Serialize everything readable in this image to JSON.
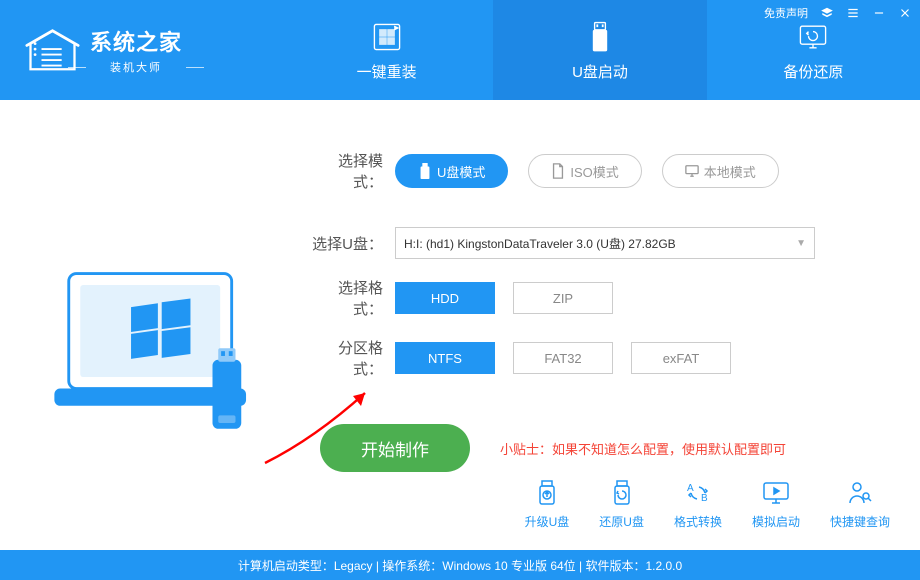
{
  "titlebar": {
    "disclaimer": "免责声明"
  },
  "logo": {
    "title": "系统之家",
    "subtitle": "装机大师"
  },
  "tabs": [
    {
      "label": "一键重装",
      "active": false
    },
    {
      "label": "U盘启动",
      "active": true
    },
    {
      "label": "备份还原",
      "active": false
    }
  ],
  "form": {
    "mode_label": "选择模式：",
    "modes": [
      {
        "label": "U盘模式",
        "active": true
      },
      {
        "label": "ISO模式",
        "active": false
      },
      {
        "label": "本地模式",
        "active": false
      }
    ],
    "usb_label": "选择U盘：",
    "usb_value": "H:I: (hd1) KingstonDataTraveler 3.0 (U盘) 27.82GB",
    "fmt_label": "选择格式：",
    "fmts": [
      {
        "label": "HDD",
        "active": true
      },
      {
        "label": "ZIP",
        "active": false
      }
    ],
    "part_label": "分区格式：",
    "parts": [
      {
        "label": "NTFS",
        "active": true
      },
      {
        "label": "FAT32",
        "active": false
      },
      {
        "label": "exFAT",
        "active": false
      }
    ],
    "start_label": "开始制作",
    "tip": "小贴士：如果不知道怎么配置，使用默认配置即可"
  },
  "tools": [
    {
      "label": "升级U盘"
    },
    {
      "label": "还原U盘"
    },
    {
      "label": "格式转换"
    },
    {
      "label": "模拟启动"
    },
    {
      "label": "快捷键查询"
    }
  ],
  "statusbar": "计算机启动类型：Legacy | 操作系统：Windows 10 专业版 64位 | 软件版本：1.2.0.0"
}
